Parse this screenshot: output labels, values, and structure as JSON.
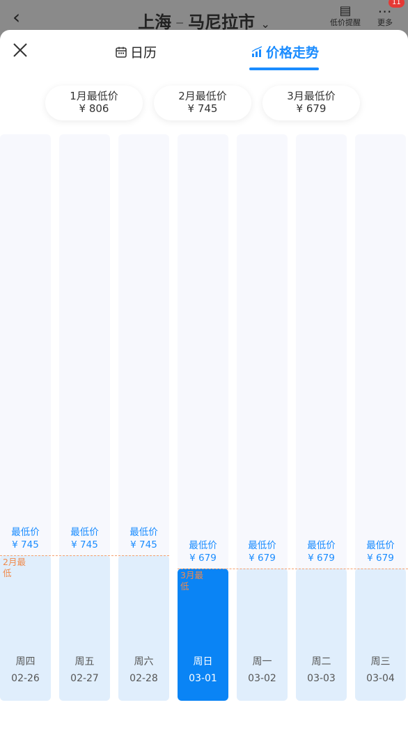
{
  "header": {
    "back_icon": "chevron-left-icon",
    "origin": "上海",
    "separator": "–",
    "destination": "马尼拉市",
    "alert_label": "低价提醒",
    "more_label": "更多",
    "badge": "11"
  },
  "tabs": {
    "calendar": "日历",
    "trend": "价格走势"
  },
  "monthly_lows": [
    {
      "month": "1月最低价",
      "price": "¥ 806"
    },
    {
      "month": "2月最低价",
      "price": "¥ 745"
    },
    {
      "month": "3月最低价",
      "price": "¥ 679"
    }
  ],
  "low_label": "最低价",
  "chart_data": {
    "type": "bar",
    "categories": [
      "02-26",
      "02-27",
      "02-28",
      "03-01",
      "03-02",
      "03-03",
      "03-04"
    ],
    "weekdays": [
      "周四",
      "周五",
      "周六",
      "周日",
      "周一",
      "周二",
      "周三"
    ],
    "values": [
      745,
      745,
      745,
      679,
      679,
      679,
      679
    ],
    "price_labels": [
      "¥ 745",
      "¥ 745",
      "¥ 745",
      "¥ 679",
      "¥ 679",
      "¥ 679",
      "¥ 679"
    ],
    "selected_index": 3,
    "annotations": [
      {
        "text": "2月最低",
        "value": 745
      },
      {
        "text": "3月最低",
        "value": 679
      }
    ]
  },
  "colors": {
    "accent": "#1a8cff",
    "selected_bar": "#0a84f5",
    "bar": "#e0eefc",
    "annotation": "#f08a4b"
  }
}
